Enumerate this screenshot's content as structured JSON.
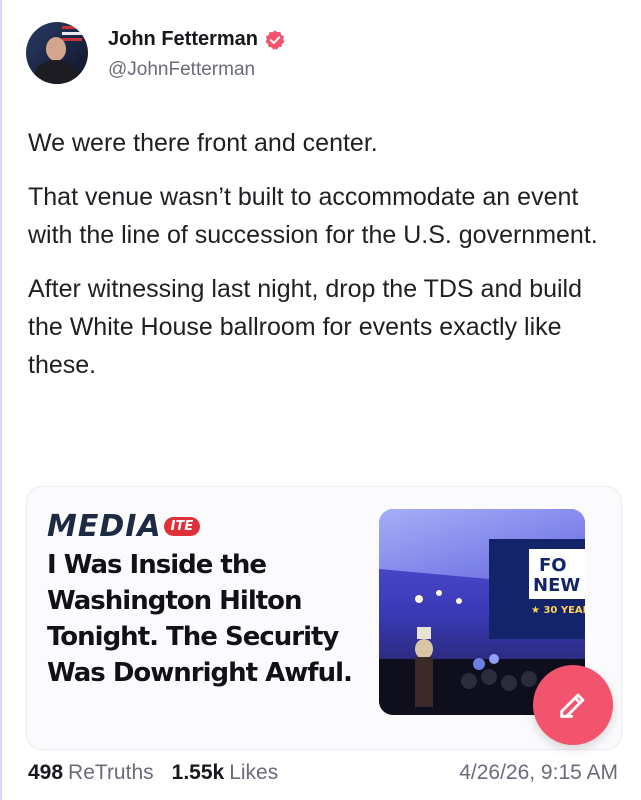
{
  "post": {
    "author_name": "John Fetterman",
    "author_handle": "@JohnFetterman",
    "verified_icon": "verified-badge-icon",
    "paragraphs": [
      "We were there front and center.",
      "That venue wasn’t built to accommodate an event with the line of succession for the U.S. government.",
      "After witnessing last night, drop the TDS and build the White House ballroom for events exactly like these."
    ]
  },
  "link_card": {
    "source_name": "MEDIA",
    "source_badge": "ITE",
    "headline": "I Was Inside the Washington Hilton Tonight. The Security Was Downright Awful.",
    "image_logo_lines": [
      "FO",
      "NEW",
      "★ 30 YEAR"
    ]
  },
  "stats": {
    "retruths_count": "498",
    "retruths_label": "ReTruths",
    "likes_count": "1.55k",
    "likes_label": "Likes",
    "timestamp": "4/26/26, 9:15 AM"
  },
  "fab": {
    "icon": "compose-pencil-icon"
  },
  "colors": {
    "accent_pink": "#f2546e",
    "verified": "#f2546e",
    "source_red": "#e0303a"
  }
}
